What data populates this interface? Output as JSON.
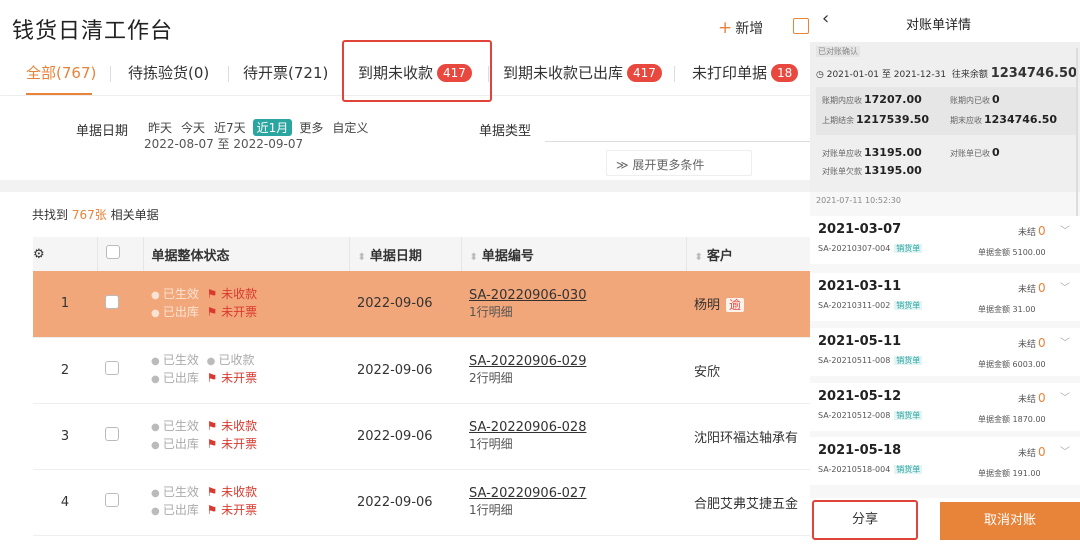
{
  "header": {
    "title": "钱货日清工作台",
    "new_label": "新增"
  },
  "tabs": [
    {
      "label": "全部(767)",
      "badge": ""
    },
    {
      "label": "待拣验货(0)",
      "badge": ""
    },
    {
      "label": "待开票(721)",
      "badge": ""
    },
    {
      "label": "到期未收款",
      "badge": "417"
    },
    {
      "label": "到期未收款已出库",
      "badge": "417"
    },
    {
      "label": "未打印单据",
      "badge": "18"
    }
  ],
  "filters": {
    "date_label": "单据日期",
    "date_options": [
      "昨天",
      "今天",
      "近7天",
      "近1月",
      "更多",
      "自定义"
    ],
    "date_range": "2022-08-07 至 2022-09-07",
    "type_label": "单据类型",
    "expand_label": "展开更多条件"
  },
  "summary": {
    "prefix": "共找到",
    "count": "767张",
    "suffix": "相关单据"
  },
  "table": {
    "headers": {
      "status": "单据整体状态",
      "date": "单据日期",
      "docno": "单据编号",
      "customer": "客户"
    },
    "rows": [
      {
        "idx": "1",
        "s1": "已生效",
        "s1b": "未收款",
        "s2": "已出库",
        "s2b": "未开票",
        "date": "2022-09-06",
        "docno": "SA-20220906-030",
        "lines": "1行明细",
        "customer": "杨明",
        "tag": "逾"
      },
      {
        "idx": "2",
        "s1": "已生效",
        "s1b": "已收款",
        "s2": "已出库",
        "s2b": "未开票",
        "date": "2022-09-06",
        "docno": "SA-20220906-029",
        "lines": "2行明细",
        "customer": "安欣",
        "tag": ""
      },
      {
        "idx": "3",
        "s1": "已生效",
        "s1b": "未收款",
        "s2": "已出库",
        "s2b": "未开票",
        "date": "2022-09-06",
        "docno": "SA-20220906-028",
        "lines": "1行明细",
        "customer": "沈阳环福达轴承有",
        "tag": ""
      },
      {
        "idx": "4",
        "s1": "已生效",
        "s1b": "未收款",
        "s2": "已出库",
        "s2b": "未开票",
        "date": "2022-09-06",
        "docno": "SA-20220906-027",
        "lines": "1行明细",
        "customer": "合肥艾弗艾捷五金",
        "tag": ""
      }
    ]
  },
  "panel": {
    "title": "对账单详情",
    "confirmed": "已对账确认",
    "period": "2021-01-01 至 2021-12-31",
    "balance_label": "往来余额",
    "balance": "1234746.50",
    "kv": {
      "period_recv_label": "账期内应收",
      "period_recv": "17207.00",
      "period_got_label": "账期内已收",
      "period_got": "0",
      "prev_label": "上期结余",
      "prev": "1217539.50",
      "end_label": "期末应收",
      "end": "1234746.50",
      "stmt_recv_label": "对账单应收",
      "stmt_recv": "13195.00",
      "stmt_got_label": "对账单已收",
      "stmt_got": "0",
      "stmt_owe_label": "对账单欠款",
      "stmt_owe": "13195.00"
    },
    "time": "2021-07-11 10:52:30",
    "items": [
      {
        "date": "2021-03-07",
        "no": "SA-20210307-004",
        "tag": "销货单",
        "status": "未结",
        "count": "0",
        "amount": "单据金额 5100.00"
      },
      {
        "date": "2021-03-11",
        "no": "SA-20210311-002",
        "tag": "销货单",
        "status": "未结",
        "count": "0",
        "amount": "单据金额 31.00"
      },
      {
        "date": "2021-05-11",
        "no": "SA-20210511-008",
        "tag": "销货单",
        "status": "未结",
        "count": "0",
        "amount": "单据金额 6003.00"
      },
      {
        "date": "2021-05-12",
        "no": "SA-20210512-008",
        "tag": "销货单",
        "status": "未结",
        "count": "0",
        "amount": "单据金额 1870.00"
      },
      {
        "date": "2021-05-18",
        "no": "SA-20210518-004",
        "tag": "销货单",
        "status": "未结",
        "count": "0",
        "amount": "单据金额 191.00"
      }
    ],
    "share_label": "分享",
    "cancel_label": "取消对账"
  }
}
